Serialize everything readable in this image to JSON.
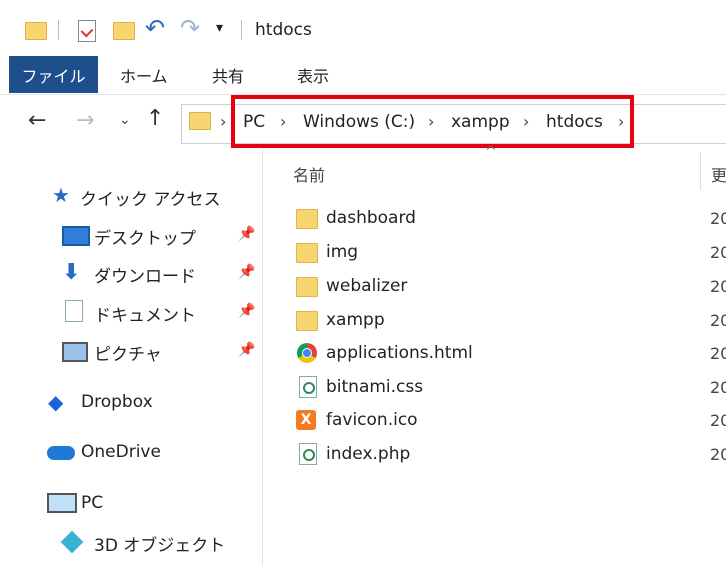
{
  "titlebar": {
    "title": "htdocs"
  },
  "ribbon": {
    "file": "ファイル",
    "tabs": [
      "ホーム",
      "共有",
      "表示"
    ]
  },
  "breadcrumb": [
    "PC",
    "Windows (C:)",
    "xampp",
    "htdocs"
  ],
  "nav": {
    "quick_access": "クイック アクセス",
    "pinned": [
      "デスクトップ",
      "ダウンロード",
      "ドキュメント",
      "ピクチャ"
    ],
    "dropbox": "Dropbox",
    "onedrive": "OneDrive",
    "pc": "PC",
    "objects3d": "3D オブジェクト"
  },
  "filelist": {
    "col_name": "名前",
    "col_date_partial": "更",
    "date_partial": "20",
    "items": [
      {
        "name": "dashboard",
        "icon": "folder-icon"
      },
      {
        "name": "img",
        "icon": "folder-icon"
      },
      {
        "name": "webalizer",
        "icon": "folder-icon"
      },
      {
        "name": "xampp",
        "icon": "folder-icon"
      },
      {
        "name": "applications.html",
        "icon": "chrome-icon"
      },
      {
        "name": "bitnami.css",
        "icon": "css-file-icon"
      },
      {
        "name": "favicon.ico",
        "icon": "xampp-icon"
      },
      {
        "name": "index.php",
        "icon": "php-file-icon"
      }
    ]
  },
  "colors": {
    "accent": "#1f4e8c",
    "highlight": "#e60012",
    "folder": "#f7d570"
  }
}
